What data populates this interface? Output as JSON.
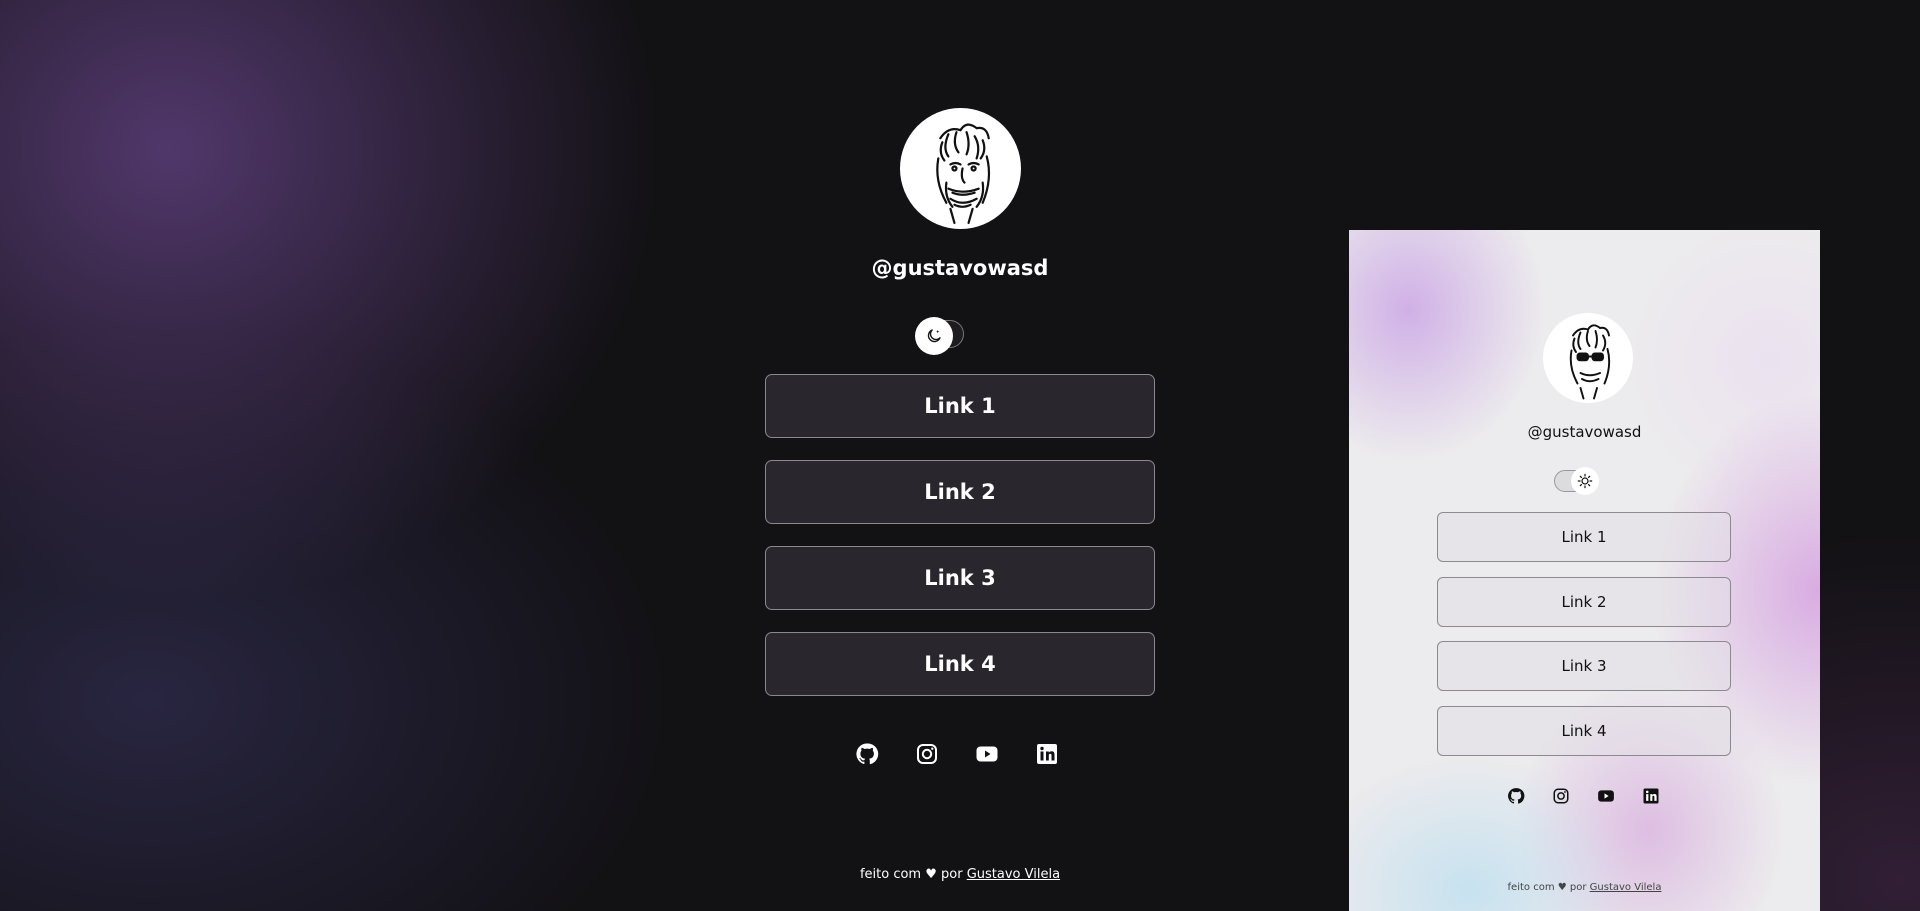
{
  "profile": {
    "username": "@gustavowasd",
    "links": [
      {
        "label": "Link 1"
      },
      {
        "label": "Link 2"
      },
      {
        "label": "Link 3"
      },
      {
        "label": "Link 4"
      }
    ],
    "socials": [
      "github-icon",
      "instagram-icon",
      "youtube-icon",
      "linkedin-icon"
    ],
    "footer": {
      "text": "feito com ♥ por",
      "author": "Gustavo Vilela"
    }
  },
  "theme": {
    "dark": {
      "mode_icon": "moon-icon",
      "accent": "#ffffff",
      "background": "#121114"
    },
    "light": {
      "mode_icon": "sun-icon",
      "accent": "#111111",
      "background": "#ecebed"
    }
  },
  "preview": {
    "username": "@gustavowasd",
    "links": [
      {
        "label": "Link 1"
      },
      {
        "label": "Link 2"
      },
      {
        "label": "Link 3"
      },
      {
        "label": "Link 4"
      }
    ],
    "footer": {
      "text": "feito com ♥ por",
      "author": "Gustavo Vilela"
    }
  }
}
